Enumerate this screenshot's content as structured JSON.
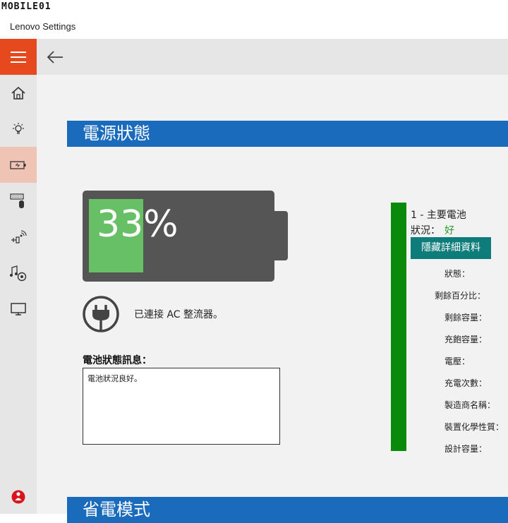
{
  "watermark": "MOBILE01",
  "window": {
    "title": "Lenovo Settings"
  },
  "sidebar": {
    "menu_icon": "hamburger-icon",
    "items": [
      {
        "icon": "home-icon"
      },
      {
        "icon": "lightbulb-icon"
      },
      {
        "icon": "battery-icon",
        "active": true
      },
      {
        "icon": "keyboard-mouse-icon"
      },
      {
        "icon": "network-icon"
      },
      {
        "icon": "audio-camera-icon"
      },
      {
        "icon": "display-icon"
      }
    ],
    "help_icon": "help-icon"
  },
  "topbar": {
    "back_icon": "back-arrow-icon"
  },
  "power": {
    "section_title": "電源狀態",
    "battery_percent": "33%",
    "battery_level": 0.33,
    "ac_status": "已連接 AC 整流器。",
    "message_label": "電池狀態訊息：",
    "message_text": "電池狀況良好。"
  },
  "battery_info": {
    "name": "1 - 主要電池",
    "status_label": "狀況：",
    "status_value": "好",
    "hide_button": "隱藏詳細資料",
    "details": [
      "狀態：",
      "剩餘百分比：",
      "剩餘容量：",
      "充飽容量：",
      "電壓：",
      "充電次數：",
      "製造商名稱：",
      "裝置化學性質：",
      "設計容量："
    ]
  },
  "next_section": {
    "title": "省電模式"
  },
  "colors": {
    "accent_orange": "#e6491e",
    "header_blue": "#1b6bbd",
    "battery_green": "#67c065",
    "battery_gray": "#555555",
    "status_green": "#0a8a0a",
    "button_teal": "#0e7c7b"
  }
}
